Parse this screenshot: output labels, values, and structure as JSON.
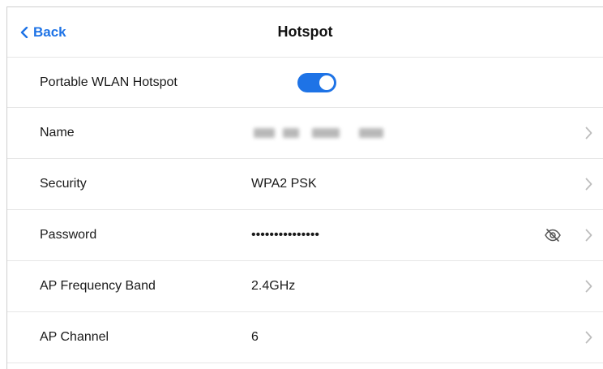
{
  "header": {
    "back_label": "Back",
    "title": "Hotspot"
  },
  "rows": [
    {
      "label": "Portable WLAN Hotspot",
      "toggle_on": true
    },
    {
      "label": "Name",
      "value_obscured": true
    },
    {
      "label": "Security",
      "value": "WPA2 PSK"
    },
    {
      "label": "Password",
      "value": "•••••••••••••••",
      "visibility_icon": "eye-off-icon"
    },
    {
      "label": "AP Frequency Band",
      "value": "2.4GHz"
    },
    {
      "label": "AP Channel",
      "value": "6"
    }
  ],
  "colors": {
    "accent": "#1e73e6",
    "divider": "#e6e6e6",
    "chevron": "#bdbdbd"
  }
}
